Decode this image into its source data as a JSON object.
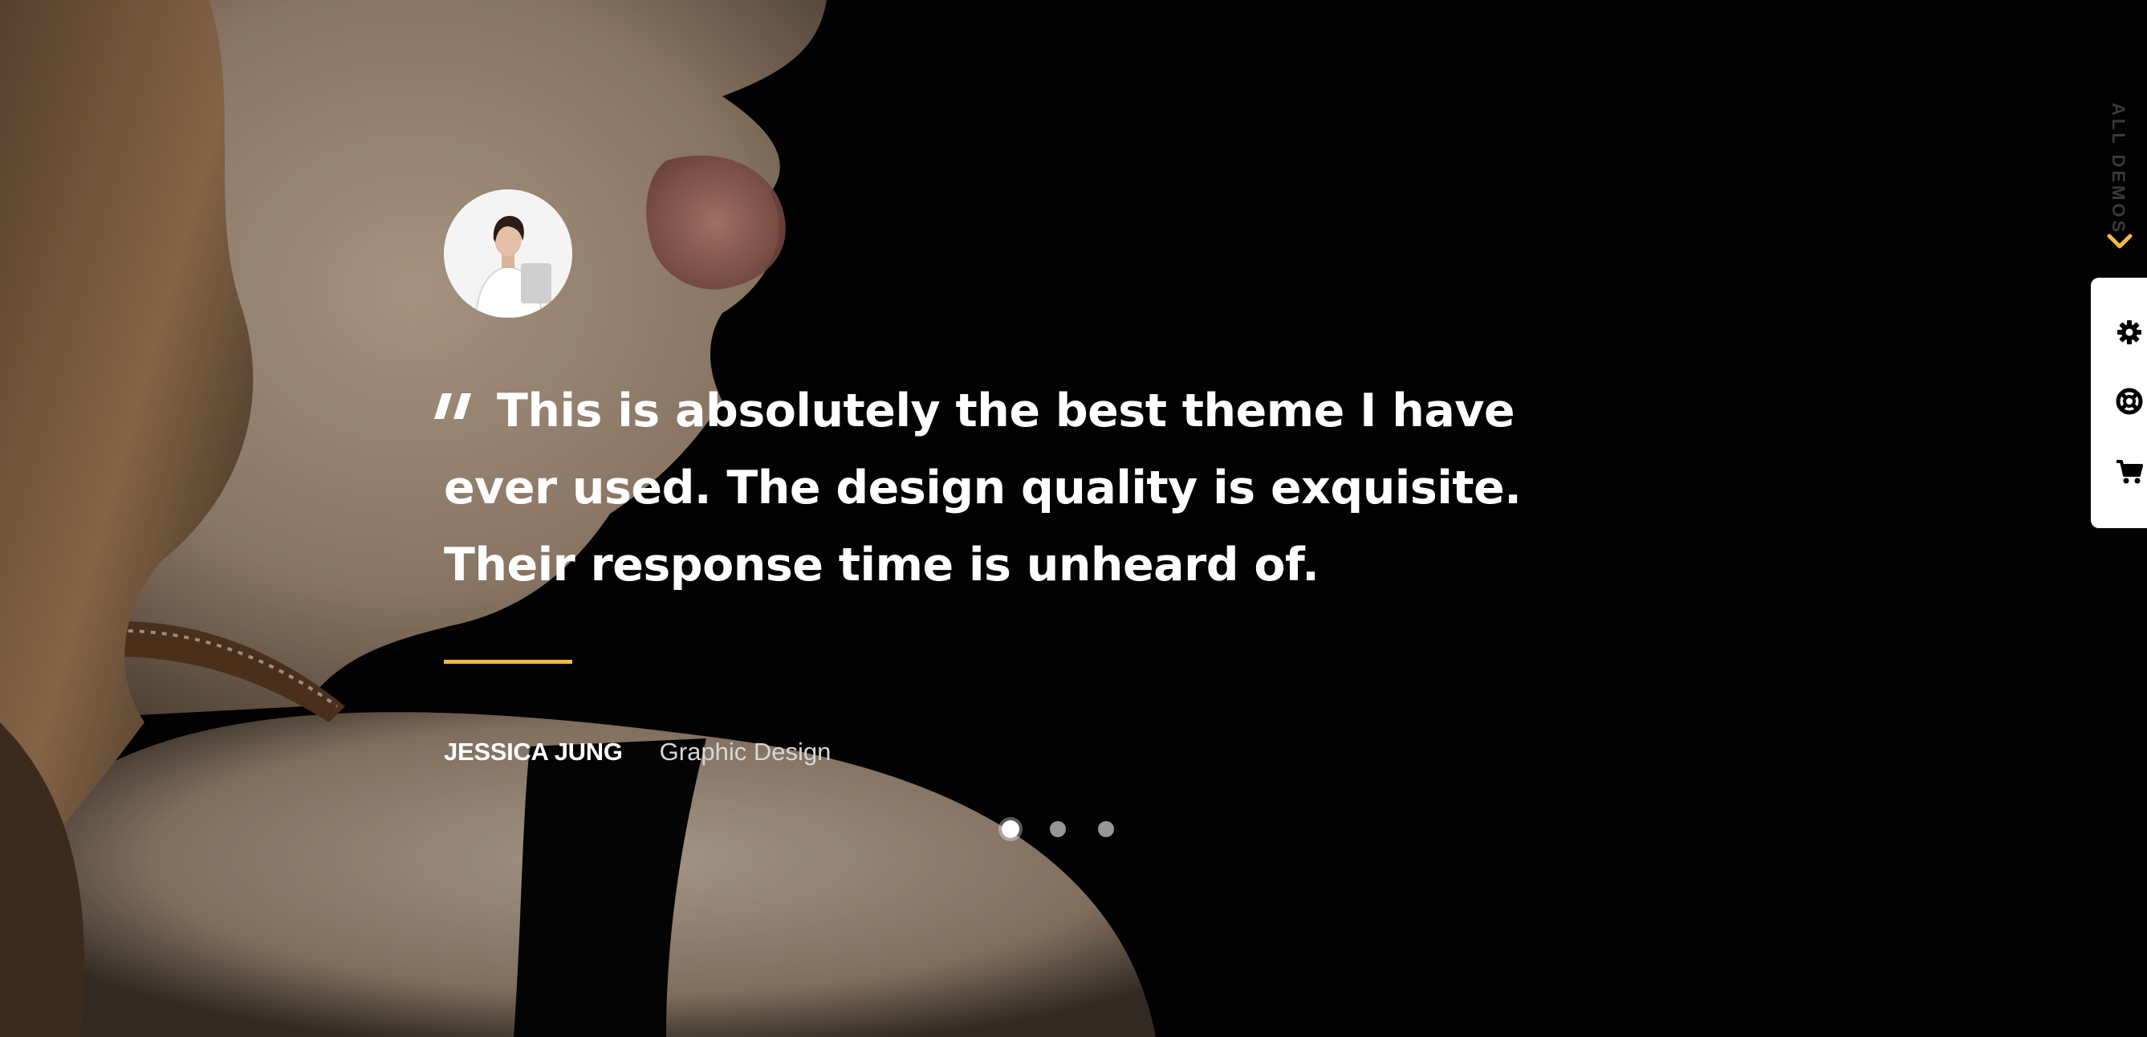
{
  "testimonial": {
    "quote": "This is absolutely the best theme I have ever used. The design quality is exquisite. Their response time is unheard of.",
    "author_name": "JESSICA JUNG",
    "author_role": "Graphic Design"
  },
  "slider": {
    "total_slides": 3,
    "active_slide": 1
  },
  "side_widgets": {
    "all_demos_label": "ALL DEMOS",
    "buttons": [
      {
        "icon": "gear-icon"
      },
      {
        "icon": "lifebuoy-icon"
      },
      {
        "icon": "cart-icon"
      }
    ]
  },
  "colors": {
    "accent": "#f0b84a",
    "background": "#030303",
    "text": "#ffffff"
  }
}
